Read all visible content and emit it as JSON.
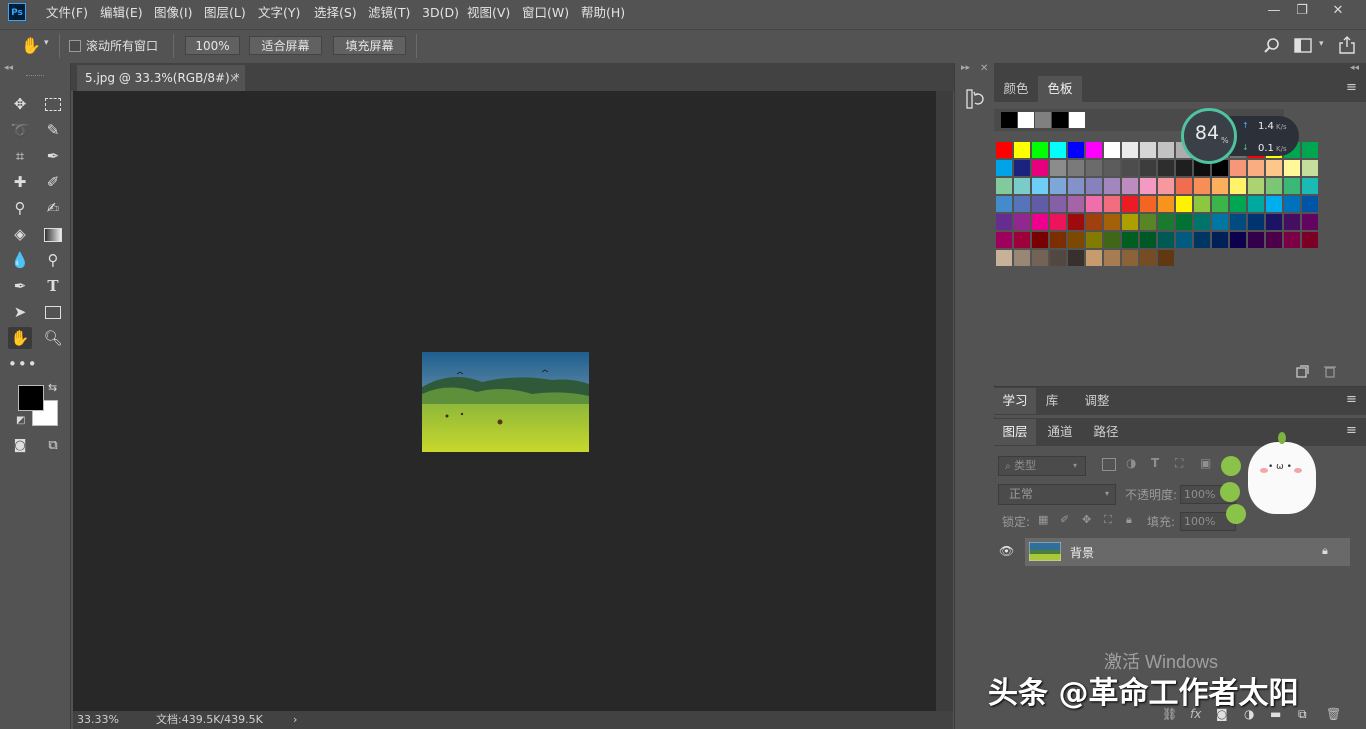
{
  "app": {
    "logo": "Ps"
  },
  "menu": [
    "文件(F)",
    "编辑(E)",
    "图像(I)",
    "图层(L)",
    "文字(Y)",
    "选择(S)",
    "滤镜(T)",
    "3D(D)",
    "视图(V)",
    "窗口(W)",
    "帮助(H)"
  ],
  "window_controls": {
    "minimize": "—",
    "restore": "❐",
    "close": "✕"
  },
  "options": {
    "scroll_all_label": "滚动所有窗口",
    "zoom_value": "100%",
    "fit_screen_label": "适合屏幕",
    "fill_screen_label": "填充屏幕"
  },
  "document": {
    "tab_title": "5.jpg @ 33.3%(RGB/8#) *",
    "close": "×"
  },
  "status": {
    "zoom": "33.33%",
    "doc_info": "文档:439.5K/439.5K",
    "arrow": "›"
  },
  "swatch_panel": {
    "tabs": [
      "颜色",
      "色板"
    ],
    "active_tab": "色板"
  },
  "net_meter": {
    "value": "84",
    "unit": "%",
    "up": "1.4",
    "down": "0.1",
    "rate_unit": "K/s"
  },
  "learn_panel": {
    "tabs": [
      "学习",
      "库",
      "调整"
    ]
  },
  "layers_panel": {
    "tabs": [
      "图层",
      "通道",
      "路径"
    ],
    "filter_kind": "类型",
    "blend_mode": "正常",
    "opacity_label": "不透明度:",
    "opacity_value": "100%",
    "lock_label": "锁定:",
    "fill_label": "填充:",
    "fill_value": "100%",
    "layers": [
      {
        "name": "背景"
      }
    ]
  },
  "watermark": {
    "activate": "激活 Windows",
    "credit": "头条 @革命工作者太阳"
  },
  "colors": {
    "menubar": "#535353",
    "canvas": "#282828",
    "accent": "#31a8ff"
  },
  "swatch_rows": [
    [
      "#ff0000",
      "#ffff00",
      "#00ff00",
      "#00ffff",
      "#0000ff",
      "#ff00ff",
      "#ffffff",
      "#ebebeb",
      "#d6d6d6",
      "#c2c2c2",
      "#adadad",
      "#999999",
      "#858585",
      "#707070",
      "#ff0000",
      "#ffff00",
      "#00a650",
      "#00a650"
    ],
    [
      "#00a2e8",
      "#1a237e",
      "#e6007e",
      "#8c8c8c",
      "#7a7a7a",
      "#6b6b6b",
      "#5c5c5c",
      "#4d4d4d",
      "#3d3d3d",
      "#2e2e2e",
      "#1f1f1f",
      "#0f0f0f",
      "#000000",
      "#f7977a",
      "#f9ad81",
      "#fdc68a",
      "#fff79a",
      "#c4df9b"
    ],
    [
      "#82ca9c",
      "#7accc8",
      "#6dcff6",
      "#7da7d9",
      "#8393ca",
      "#8781bd",
      "#a187be",
      "#bc8cbf",
      "#f49ac2",
      "#f6989d",
      "#f26c4f",
      "#f68e55",
      "#fbaf5c",
      "#fff467",
      "#acd372",
      "#7cc576",
      "#3bb878",
      "#1abbb4"
    ],
    [
      "#438ccb",
      "#5574b9",
      "#605ca8",
      "#855fa8",
      "#a763a8",
      "#f06ea9",
      "#f26d7d",
      "#ed1c24",
      "#f26522",
      "#f7941d",
      "#fff200",
      "#8dc73f",
      "#39b54a",
      "#00a651",
      "#00a99d",
      "#00aeef",
      "#0072bc",
      "#0054a6"
    ],
    [
      "#662d91",
      "#92278f",
      "#ec008c",
      "#ed145b",
      "#9e0b0f",
      "#a0410d",
      "#a36209",
      "#aba000",
      "#598527",
      "#1a7b30",
      "#007236",
      "#00746b",
      "#0076a3",
      "#004b80",
      "#003471",
      "#1b1464",
      "#440e62",
      "#630460"
    ],
    [
      "#9e005d",
      "#9e0039",
      "#790000",
      "#7b2e00",
      "#7d4900",
      "#827b00",
      "#406618",
      "#005e20",
      "#005826",
      "#005952",
      "#005b7f",
      "#003663",
      "#002157",
      "#0d004c",
      "#32004b",
      "#4b0049",
      "#7b0046",
      "#7a0026"
    ],
    [
      "#c7b299",
      "#998675",
      "#736357",
      "#534741",
      "#37302d",
      "#c69c6d",
      "#a67c52",
      "#8c6239",
      "#754c24",
      "#603913"
    ]
  ]
}
